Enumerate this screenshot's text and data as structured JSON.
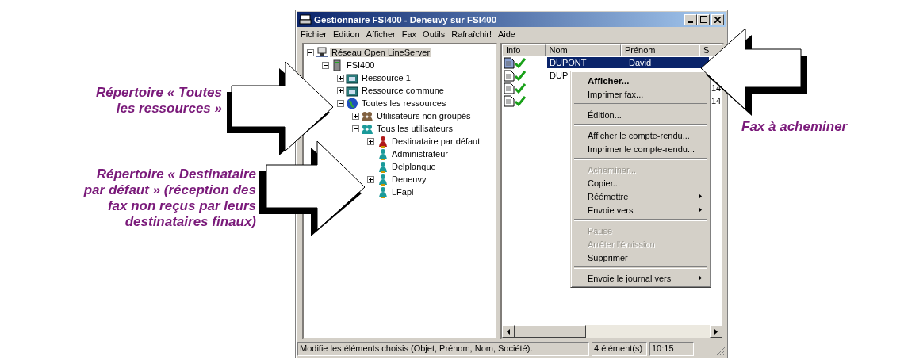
{
  "window": {
    "title": "Gestionnaire FSI400 - Deneuvy sur FSI400"
  },
  "menu": [
    "Fichier",
    "Edition",
    "Afficher",
    "Fax",
    "Outils",
    "Rafraîchir!",
    "Aide"
  ],
  "tree": [
    {
      "label": "Réseau Open LineServer",
      "kind": "network",
      "expanded": true,
      "selected": true,
      "children": [
        {
          "label": "FSI400",
          "kind": "server",
          "expanded": true,
          "selected": false,
          "children": [
            {
              "label": "Ressource  1",
              "kind": "resource",
              "expanded": false,
              "selected": false
            },
            {
              "label": "Ressource commune",
              "kind": "resource",
              "expanded": false,
              "selected": false
            },
            {
              "label": "Toutes les ressources",
              "kind": "globe",
              "expanded": true,
              "selected": false,
              "children": [
                {
                  "label": "Utilisateurs non groupés",
                  "kind": "people",
                  "expanded": false,
                  "selected": false
                },
                {
                  "label": "Tous les utilisateurs",
                  "kind": "group",
                  "expanded": true,
                  "selected": false,
                  "children": [
                    {
                      "label": "Destinataire par défaut",
                      "kind": "user-red",
                      "expanded": false,
                      "selected": false
                    },
                    {
                      "label": "Administrateur",
                      "kind": "user",
                      "selected": false
                    },
                    {
                      "label": "Delplanque",
                      "kind": "user",
                      "selected": false
                    },
                    {
                      "label": "Deneuvy",
                      "kind": "user",
                      "expanded": false,
                      "selected": false
                    },
                    {
                      "label": "LFapi",
                      "kind": "user",
                      "selected": false
                    }
                  ]
                }
              ]
            }
          ]
        }
      ]
    }
  ],
  "list": {
    "columns": [
      "Info",
      "Nom",
      "Prénom",
      "S"
    ],
    "rows": [
      {
        "nom": "DUPONT",
        "prenom": "David",
        "column_4": "",
        "selected": true
      },
      {
        "nom": "DUP",
        "prenom": "",
        "column_4": "",
        "selected": false
      },
      {
        "nom": "",
        "prenom": "",
        "column_4": "14",
        "selected": false
      },
      {
        "nom": "",
        "prenom": "",
        "column_4": "14",
        "selected": false
      }
    ]
  },
  "context_menu": [
    {
      "kind": "item",
      "label": "Afficher...",
      "default": true,
      "disabled": false,
      "submenu": false
    },
    {
      "kind": "item",
      "label": "Imprimer fax...",
      "default": false,
      "disabled": false,
      "submenu": false
    },
    {
      "kind": "separator"
    },
    {
      "kind": "item",
      "label": "Édition...",
      "default": false,
      "disabled": false,
      "submenu": false
    },
    {
      "kind": "separator"
    },
    {
      "kind": "item",
      "label": "Afficher le compte-rendu...",
      "default": false,
      "disabled": false,
      "submenu": false
    },
    {
      "kind": "item",
      "label": "Imprimer le compte-rendu...",
      "default": false,
      "disabled": false,
      "submenu": false
    },
    {
      "kind": "separator"
    },
    {
      "kind": "item",
      "label": "Acheminer...",
      "default": false,
      "disabled": true,
      "submenu": false
    },
    {
      "kind": "item",
      "label": "Copier...",
      "default": false,
      "disabled": false,
      "submenu": false
    },
    {
      "kind": "item",
      "label": "Réémettre",
      "default": false,
      "disabled": false,
      "submenu": true
    },
    {
      "kind": "item",
      "label": "Envoie vers",
      "default": false,
      "disabled": false,
      "submenu": true
    },
    {
      "kind": "separator"
    },
    {
      "kind": "item",
      "label": "Pause",
      "default": false,
      "disabled": true,
      "submenu": false
    },
    {
      "kind": "item",
      "label": "Arrêter l'émission",
      "default": false,
      "disabled": true,
      "submenu": false
    },
    {
      "kind": "item",
      "label": "Supprimer",
      "default": false,
      "disabled": false,
      "submenu": false
    },
    {
      "kind": "separator"
    },
    {
      "kind": "item",
      "label": "Envoie le journal vers",
      "default": false,
      "disabled": false,
      "submenu": true
    }
  ],
  "status_bar": [
    "Modifie les éléments choisis (Objet, Prénom, Nom, Société).",
    "4 élément(s)",
    "10:15"
  ],
  "callouts": [
    {
      "lines": [
        "Répertoire « Toutes",
        "les ressources »"
      ]
    },
    {
      "lines": [
        "Répertoire « Destinataire",
        "par défaut » (réception des",
        "fax non reçus par leurs",
        "destinataires finaux)"
      ]
    },
    {
      "lines": [
        "Fax à acheminer"
      ]
    }
  ]
}
